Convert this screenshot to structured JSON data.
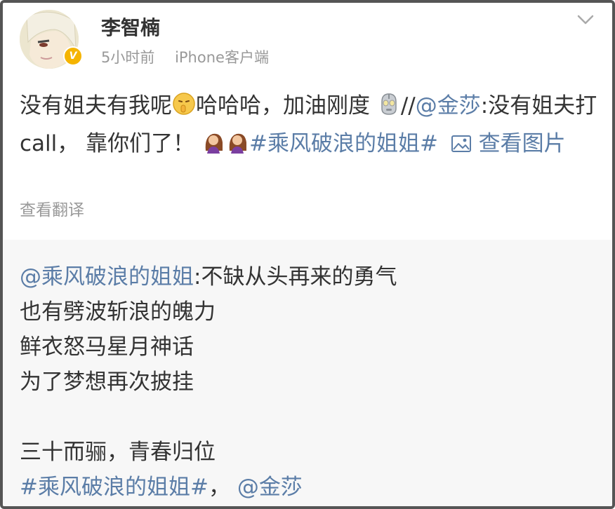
{
  "user": {
    "name": "李智楠",
    "time": "5小时前",
    "source": "iPhone客户端",
    "verified_badge": "V"
  },
  "post": {
    "text_1": "没有姐夫有我呢",
    "text_2": "哈哈哈，加油刚度",
    "text_3": "//",
    "mention_1": "@金莎",
    "text_4": ":没有姐夫打call， 靠你们了！",
    "hashtag": "#乘风破浪的姐姐#",
    "view_image": "查看图片",
    "translate": "查看翻译"
  },
  "repost": {
    "mention": "@乘风破浪的姐姐",
    "line_1": ":不缺从头再来的勇气",
    "line_2": "也有劈波斩浪的魄力",
    "line_3": "鲜衣怒马星月神话",
    "line_4": "为了梦想再次披挂",
    "line_5": "三十而骊，青春归位",
    "hashtag": "#乘风破浪的姐姐#",
    "separator": "，",
    "mention_2": "@金莎"
  },
  "icons": [
    "chevron-down-icon",
    "shush-emoji-icon",
    "robot-emoji-icon",
    "woman-emoji-icon",
    "image-icon",
    "verified-icon"
  ],
  "colors": {
    "link": "#5b7da7",
    "text": "#333333",
    "meta": "#999999",
    "repost_bg": "#f7f7f7",
    "badge": "#f5b400"
  }
}
